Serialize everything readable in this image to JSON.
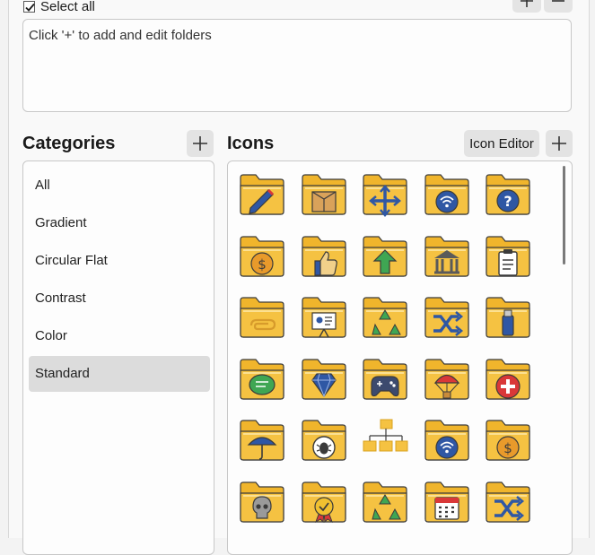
{
  "top": {
    "select_all_label": "Select all",
    "select_all_checked": true,
    "add_icon": "plus-icon",
    "remove_icon": "minus-icon"
  },
  "folders": {
    "placeholder": "Click '+' to add and edit folders"
  },
  "categories": {
    "title": "Categories",
    "add_icon": "plus-icon",
    "items": [
      {
        "label": "All",
        "selected": false
      },
      {
        "label": "Gradient",
        "selected": false
      },
      {
        "label": "Circular Flat",
        "selected": false
      },
      {
        "label": "Contrast",
        "selected": false
      },
      {
        "label": "Color",
        "selected": false
      },
      {
        "label": "Standard",
        "selected": true
      }
    ]
  },
  "icons": {
    "title": "Icons",
    "editor_label": "Icon Editor",
    "add_icon": "plus-icon",
    "grid": [
      [
        "pencil-folder-icon",
        "box-folder-icon",
        "move-arrows-folder-icon",
        "wifi-folder-icon",
        "question-folder-icon"
      ],
      [
        "dollar-folder-icon",
        "thumbs-up-folder-icon",
        "upload-folder-icon",
        "bank-folder-icon",
        "clipboard-folder-icon"
      ],
      [
        "paperclip-folder-icon",
        "presentation-folder-icon",
        "recycle-folder-icon",
        "shuffle-folder-icon",
        "usb-folder-icon"
      ],
      [
        "chat-folder-icon",
        "diamond-folder-icon",
        "gamepad-folder-icon",
        "parachute-folder-icon",
        "medical-cross-folder-icon"
      ],
      [
        "umbrella-folder-icon",
        "bug-folder-icon",
        "network-folder-icon",
        "wifi-folder-icon",
        "dollar-folder-icon"
      ],
      [
        "skull-folder-icon",
        "award-folder-icon",
        "recycle-folder-icon",
        "calendar-folder-icon",
        "shuffle-folder-icon"
      ]
    ]
  },
  "colors": {
    "folder_yellow": "#f5c242",
    "folder_back": "#f0b52c",
    "folder_outline": "#3b3b3b",
    "emblem_blue": "#2f57a4",
    "emblem_orange": "#e89a2b",
    "emblem_green": "#3fa653",
    "emblem_red": "#d93838"
  }
}
